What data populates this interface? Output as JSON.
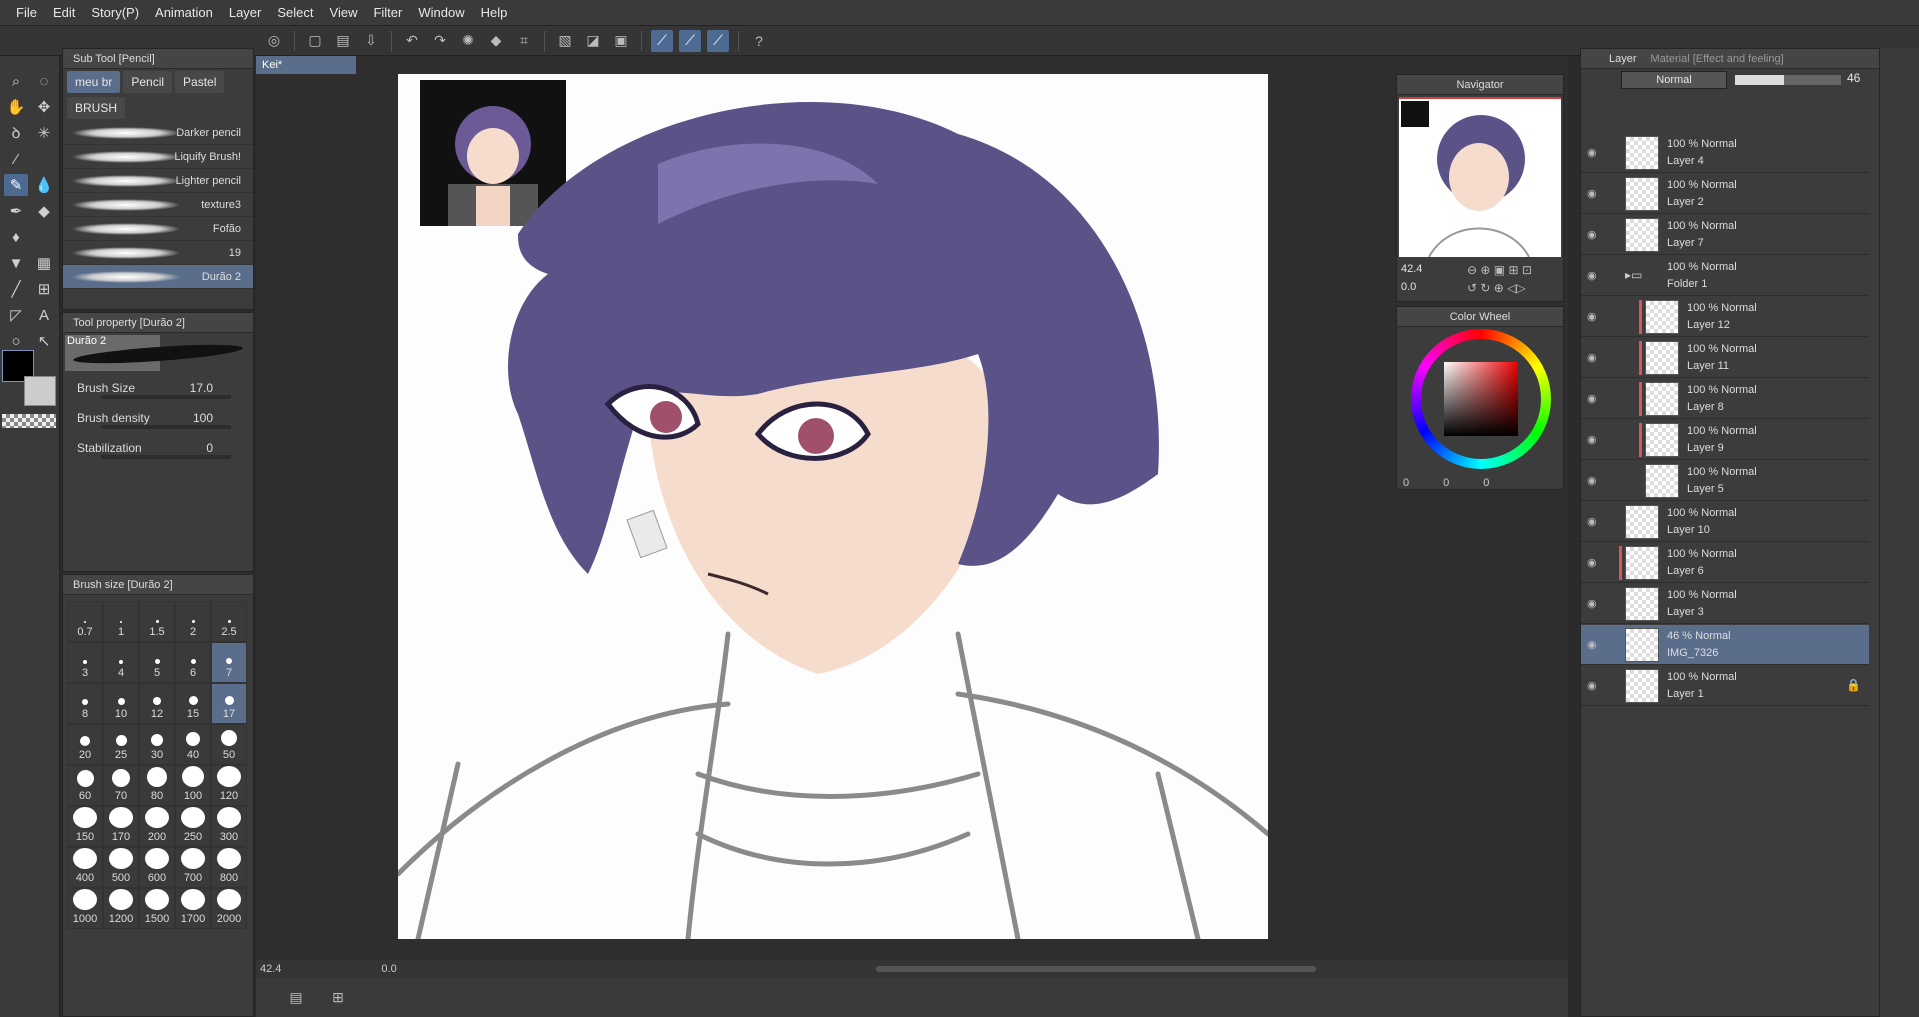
{
  "menu": [
    "File",
    "Edit",
    "Story(P)",
    "Animation",
    "Layer",
    "Select",
    "View",
    "Filter",
    "Window",
    "Help"
  ],
  "subtool": {
    "title": "Sub Tool [Pencil]",
    "tabs": [
      "meu br",
      "Pencil",
      "Pastel",
      "BRUSH"
    ],
    "brushes": [
      "Darker pencil",
      "Liquify Brush!",
      "Lighter pencil",
      "texture3",
      "Fofão",
      "19",
      "Durão 2"
    ]
  },
  "toolprop": {
    "title": "Tool property [Durão 2]",
    "brush_name": "Durão 2",
    "size_label": "Brush Size",
    "size_value": "17.0",
    "density_label": "Brush density",
    "density_value": "100",
    "stab_label": "Stabilization",
    "stab_value": "0"
  },
  "brushsize": {
    "title": "Brush size [Durão 2]",
    "sizes": [
      "0.7",
      "1",
      "1.5",
      "2",
      "2.5",
      "3",
      "4",
      "5",
      "6",
      "7",
      "8",
      "10",
      "12",
      "15",
      "17",
      "20",
      "25",
      "30",
      "40",
      "50",
      "60",
      "70",
      "80",
      "100",
      "120",
      "150",
      "170",
      "200",
      "250",
      "300",
      "400",
      "500",
      "600",
      "700",
      "800",
      "1000",
      "1200",
      "1500",
      "1700",
      "2000"
    ],
    "active": [
      "7",
      "17"
    ]
  },
  "document": {
    "tab": "Kei*"
  },
  "status": {
    "zoom": "42.4",
    "rotation": "0.0"
  },
  "navigator": {
    "title": "Navigator",
    "zoom": "42.4",
    "rotation": "0.0"
  },
  "colorwheel": {
    "title": "Color Wheel",
    "values": [
      "0",
      "0",
      "0"
    ]
  },
  "layer_panel": {
    "tabs": [
      "Layer",
      "Material [Effect and feeling]"
    ],
    "blend_mode": "Normal",
    "opacity": "46",
    "layers": [
      {
        "blend": "100 % Normal",
        "name": "Layer 4",
        "indent": 0,
        "clip": false
      },
      {
        "blend": "100 % Normal",
        "name": "Layer 2",
        "indent": 0,
        "clip": false
      },
      {
        "blend": "100 % Normal",
        "name": "Layer 7",
        "indent": 0,
        "clip": false
      },
      {
        "blend": "100 % Normal",
        "name": "Folder 1",
        "indent": 0,
        "clip": false,
        "folder": true
      },
      {
        "blend": "100 % Normal",
        "name": "Layer 12",
        "indent": 1,
        "clip": true
      },
      {
        "blend": "100 % Normal",
        "name": "Layer 11",
        "indent": 1,
        "clip": true
      },
      {
        "blend": "100 % Normal",
        "name": "Layer 8",
        "indent": 1,
        "clip": true
      },
      {
        "blend": "100 % Normal",
        "name": "Layer 9",
        "indent": 1,
        "clip": true
      },
      {
        "blend": "100 % Normal",
        "name": "Layer 5",
        "indent": 1,
        "clip": false
      },
      {
        "blend": "100 % Normal",
        "name": "Layer 10",
        "indent": 0,
        "clip": false
      },
      {
        "blend": "100 % Normal",
        "name": "Layer 6",
        "indent": 0,
        "clip": true
      },
      {
        "blend": "100 % Normal",
        "name": "Layer 3",
        "indent": 0,
        "clip": false
      },
      {
        "blend": "46 % Normal",
        "name": "IMG_7326",
        "indent": 0,
        "clip": false,
        "active": true
      },
      {
        "blend": "100 % Normal",
        "name": "Layer 1",
        "indent": 0,
        "clip": false,
        "locked": true
      }
    ]
  },
  "colors": {
    "accent": "#5a6e8c",
    "hair": "#5b5287",
    "skin": "#f6dccd"
  }
}
